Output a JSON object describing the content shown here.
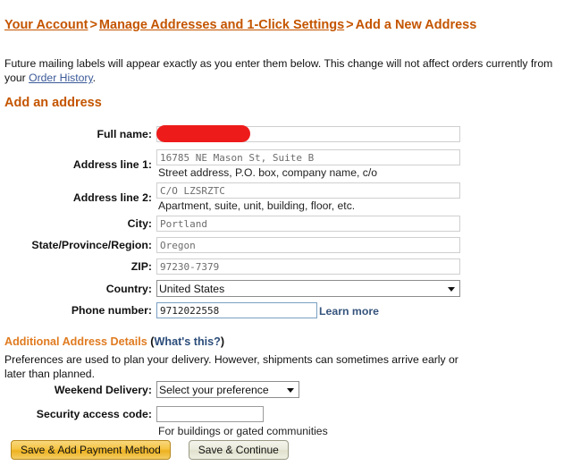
{
  "breadcrumb": {
    "item1": "Your Account",
    "sep1": ">",
    "item2": "Manage Addresses and 1-Click Settings",
    "sep2": ">",
    "current": "Add a New Address"
  },
  "intro": {
    "text_before": "Future mailing labels will appear exactly as you enter them below. This change will not affect orders currently from your ",
    "link": "Order History",
    "text_after": "."
  },
  "section_heading": "Add an address",
  "form": {
    "full_name": {
      "label": "Full name:",
      "value": "",
      "redacted": true
    },
    "address_line_1": {
      "label": "Address line 1:",
      "value": "16785 NE Mason St, Suite B",
      "hint": "Street address, P.O. box, company name, c/o"
    },
    "address_line_2": {
      "label": "Address line 2:",
      "value": "C/O LZSRZTC",
      "hint": "Apartment, suite, unit, building, floor, etc."
    },
    "city": {
      "label": "City:",
      "value": "Portland"
    },
    "state": {
      "label": "State/Province/Region:",
      "value": "Oregon"
    },
    "zip": {
      "label": "ZIP:",
      "value": "97230-7379"
    },
    "country": {
      "label": "Country:",
      "value": "United States",
      "options": [
        "United States"
      ]
    },
    "phone": {
      "label": "Phone number:",
      "value": "9712022558",
      "learn_more": "Learn more"
    }
  },
  "additional": {
    "heading": "Additional Address Details",
    "whats_this": "What's this?",
    "paren_open": "(",
    "paren_close": ")",
    "note": "Preferences are used to plan your delivery. However, shipments can sometimes arrive early or later than planned.",
    "weekend_delivery": {
      "label": "Weekend Delivery:",
      "value": "Select your preference",
      "options": [
        "Select your preference"
      ]
    },
    "security_code": {
      "label": "Security access code:",
      "value": "",
      "hint": "For buildings or gated communities"
    }
  },
  "buttons": {
    "primary": "Save & Add Payment Method",
    "secondary": "Save & Continue"
  },
  "colors": {
    "breadcrumb": "#c45500",
    "heading": "#c45500",
    "additional_heading": "#e07b20",
    "link": "#3b5998",
    "redaction": "#ee1b1b"
  }
}
